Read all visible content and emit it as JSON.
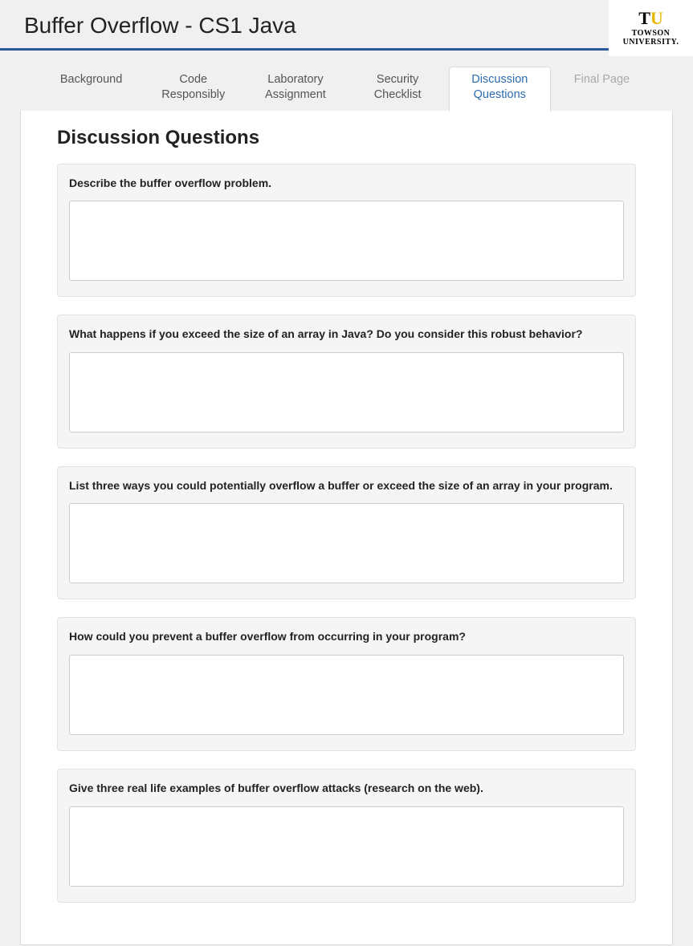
{
  "header": {
    "title": "Buffer Overflow - CS1 Java",
    "logo": {
      "letters_t": "T",
      "letters_u": "U",
      "line1": "TOWSON",
      "line2": "UNIVERSITY."
    }
  },
  "tabs": [
    {
      "label": "Background",
      "active": false,
      "disabled": false
    },
    {
      "label": "Code Responsibly",
      "active": false,
      "disabled": false
    },
    {
      "label": "Laboratory Assignment",
      "active": false,
      "disabled": false
    },
    {
      "label": "Security Checklist",
      "active": false,
      "disabled": false
    },
    {
      "label": "Discussion Questions",
      "active": true,
      "disabled": false
    },
    {
      "label": "Final Page",
      "active": false,
      "disabled": true
    }
  ],
  "content": {
    "heading": "Discussion Questions",
    "questions": [
      {
        "prompt": "Describe the buffer overflow problem.",
        "answer": ""
      },
      {
        "prompt": "What happens if you exceed the size of an array in Java? Do you consider this robust behavior?",
        "answer": ""
      },
      {
        "prompt": "List three ways you could potentially overflow a buffer or exceed the size of an array in your program.",
        "answer": ""
      },
      {
        "prompt": "How could you prevent a buffer overflow from occurring in your program?",
        "answer": ""
      },
      {
        "prompt": "Give three real life examples of buffer overflow attacks (research on the web).",
        "answer": ""
      }
    ]
  }
}
